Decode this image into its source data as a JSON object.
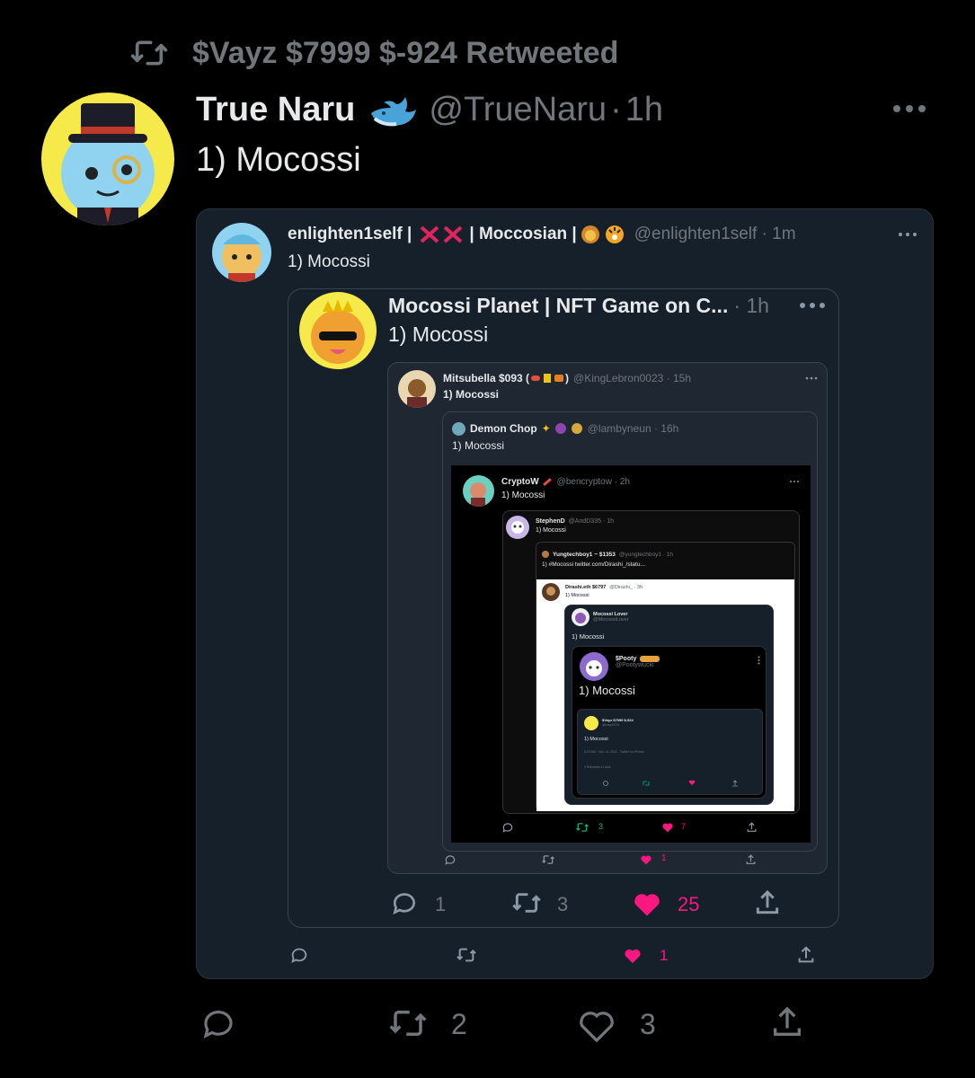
{
  "retweet_header": "$Vayz $7999 $-924 Retweeted",
  "main": {
    "display_name": "True Naru",
    "handle": "@TrueNaru",
    "time": "1h",
    "text": "1) Mocossi",
    "stats": {
      "replies": "",
      "retweets": "2",
      "likes": "3"
    }
  },
  "quote1": {
    "name": "enlighten1self | ",
    "name_tail": " | Moccosian | ",
    "handle": "@enlighten1self · 1m",
    "text": "1) Mocossi",
    "stats": {
      "replies": "",
      "retweets": "",
      "likes": "1"
    }
  },
  "quote2": {
    "name": "Mocossi Planet | NFT Game on C...",
    "time": "· 1h",
    "text": "1) Mocossi",
    "stats": {
      "replies": "1",
      "retweets": "3",
      "likes": "25"
    }
  },
  "quote3": {
    "name": "Mitsubella $093 (",
    "name_tail": ")",
    "handle": "@KingLebron0023 · 15h",
    "text": "1) Mocossi",
    "stats": {
      "replies": "",
      "retweets": "",
      "likes": "1"
    }
  },
  "quote4": {
    "name": "Demon Chop",
    "handle": "@lambyneun · 16h",
    "text": "1) Mocossi"
  },
  "quote5": {
    "name": "CryptoW",
    "handle": "@bencryptow · 2h",
    "text": "1) Mocossi",
    "stats": {
      "retweets": "3",
      "likes": "7"
    }
  },
  "quote6": {
    "name": "StephenD",
    "handle": "@AndD335 · 1h",
    "text": "1) Mocossi"
  },
  "quote7": {
    "name": "Yungtechboy1 ~ $1353",
    "handle": "@yungtechboy1 · 1h",
    "text": "1) #Mocossi  twitter.com/Dirashi_/statu..."
  },
  "quote8": {
    "name": "Dirashi.eth $6797",
    "handle": "@Dirashi_ · 3h",
    "text": "1) Mocossi"
  },
  "quote9": {
    "name": "Mocossi Lover",
    "handle": "@MocossiLover",
    "text": "1) Mocossi"
  },
  "quote10": {
    "name": "$Pooty",
    "handle": "@Pootywucki",
    "text": "1) Mocossi"
  },
  "quote11": {
    "name": "$Vayz $7999 $-924",
    "handle": "@vayz924",
    "text": "1) Mocossi",
    "meta": "6:23 AM · Nov 14, 2022 · Twitter for iPhone",
    "counts": "2 Retweets   4 Likes"
  },
  "icons": [
    "retweet-icon",
    "reply-icon",
    "like-icon",
    "share-icon",
    "more-icon",
    "whale-emoji",
    "cross-emoji",
    "lion-emoji",
    "tiger-emoji"
  ],
  "colors": {
    "like": "#f91880",
    "retweet_active": "#00ba7c",
    "muted": "#71767b",
    "card_bg": "#15202b",
    "text": "#e7e9ea"
  }
}
